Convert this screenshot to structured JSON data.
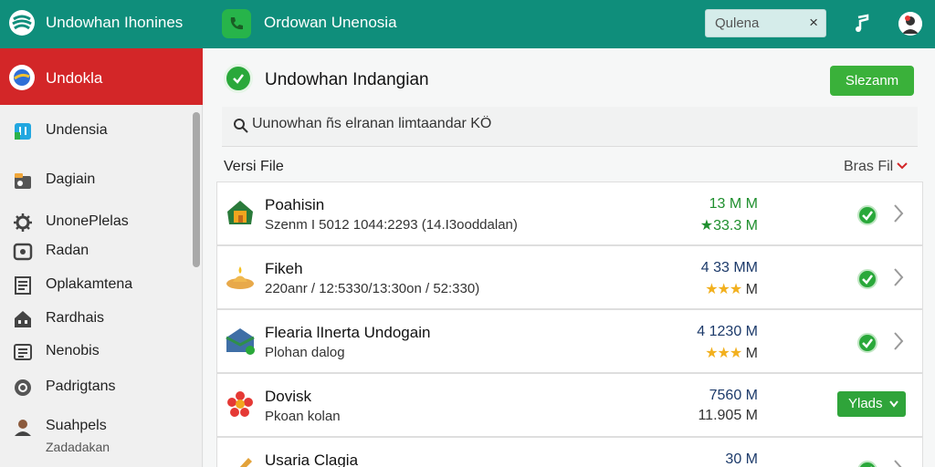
{
  "topbar": {
    "app_title": "Undowhan Ihonines",
    "window_title": "Ordowan Unenosia",
    "search_placeholder": "Qulena",
    "clear_icon": "×"
  },
  "sidebar": {
    "header_label": "Undokla",
    "items": [
      {
        "label": "Undensia",
        "icon": "file-icon"
      },
      {
        "label": "Dagiain",
        "icon": "folder-icon"
      },
      {
        "label": "UnonePlelas",
        "icon": "gear-icon"
      },
      {
        "label": "Radan",
        "icon": "image-icon"
      },
      {
        "label": "Oplakamtena",
        "icon": "document-icon"
      },
      {
        "label": "Rardhais",
        "icon": "home-icon"
      },
      {
        "label": "Nenobis",
        "icon": "network-icon"
      },
      {
        "label": "Padrigtans",
        "icon": "help-icon"
      },
      {
        "label": "Suahpels",
        "icon": "user-icon"
      }
    ],
    "footer_sub": "Zadadakan"
  },
  "main": {
    "title": "Undowhan Indangian",
    "primary_button": "Slezanm",
    "search_value": "Uunowhan ñs elranan limtaandar KÖ",
    "section_label": "Versi File",
    "sort_label": "Bras Fil",
    "accent_color": "#2aa83a",
    "rows": [
      {
        "name": "Poahisin",
        "meta": "Szenm I 5012 1044:2293 (14.I3ooddalan)",
        "val1": "13 M M",
        "val2": "★33.3 M",
        "status": "ok"
      },
      {
        "name": "Fikeh",
        "meta": "220anr / 12:5330/13:30on / 52:330)",
        "val1": "4 33 MM",
        "stars": "★★★",
        "val2": "M",
        "status": "ok"
      },
      {
        "name": "Flearia lInerta Undogain",
        "meta": "Plohan dalog",
        "val1": "4 1230 M",
        "stars": "★★★",
        "val2": "M",
        "status": "ok"
      },
      {
        "name": "Dovisk",
        "meta": "Pkoan kolan",
        "val1": "7560 M",
        "val2": "11.905 M",
        "status": "button",
        "button_label": "Ylads"
      },
      {
        "name": "Usaria Clagia",
        "meta": "",
        "val1": "30 M",
        "val2": "",
        "status": "ok"
      }
    ]
  }
}
